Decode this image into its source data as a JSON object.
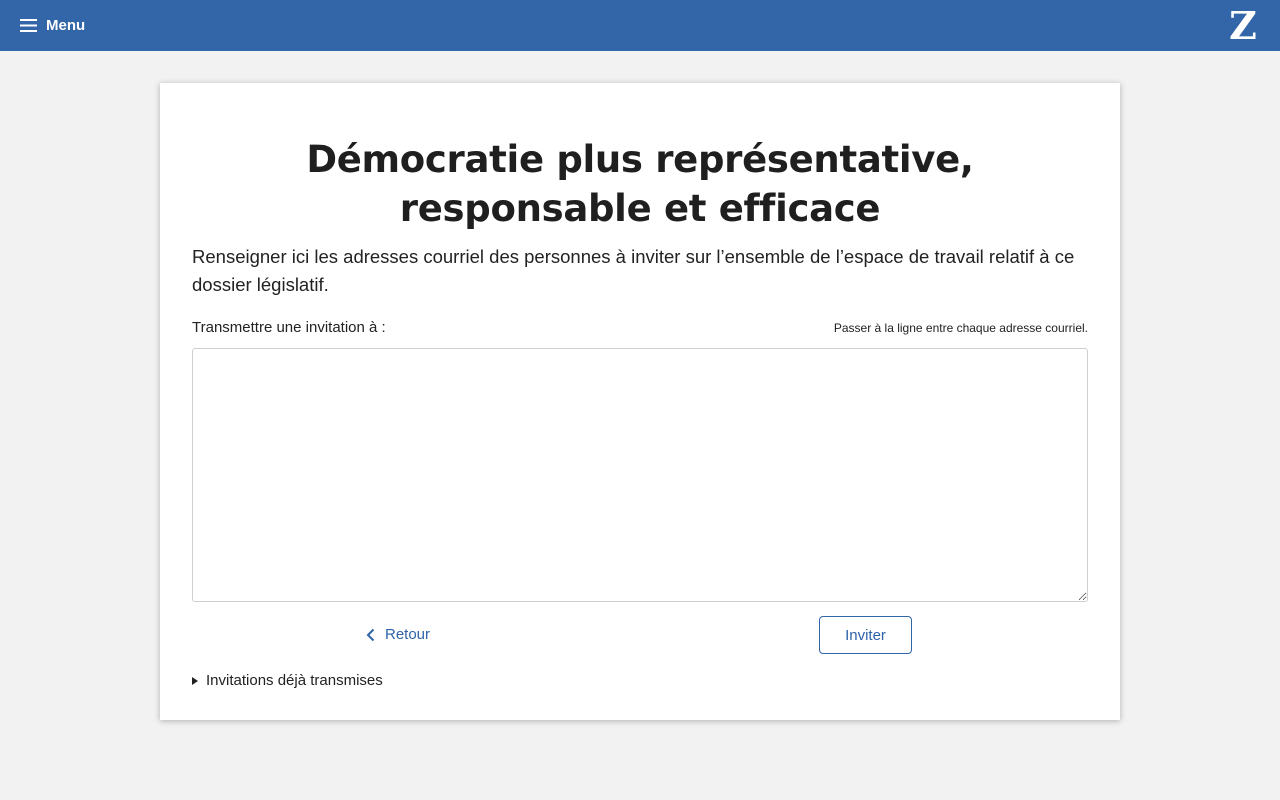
{
  "header": {
    "menu_label": "Menu",
    "menu_icon": "hamburger-icon",
    "logo_text": "Z",
    "brand_color": "#3266a8"
  },
  "page": {
    "title": "Démocratie plus représentative, responsable et efficace",
    "description": "Renseigner ici les adresses courriel des personnes à inviter sur l’ensemble de l’espace de travail relatif à ce dossier législatif.",
    "field_label": "Transmettre une invitation à :",
    "field_hint": "Passer à la ligne entre chaque adresse courriel.",
    "textarea_value": "",
    "back_label": "Retour",
    "back_icon": "chevron-left-icon",
    "invite_label": "Inviter",
    "details_label": "Invitations déjà transmises",
    "details_icon": "triangle-right-icon"
  }
}
